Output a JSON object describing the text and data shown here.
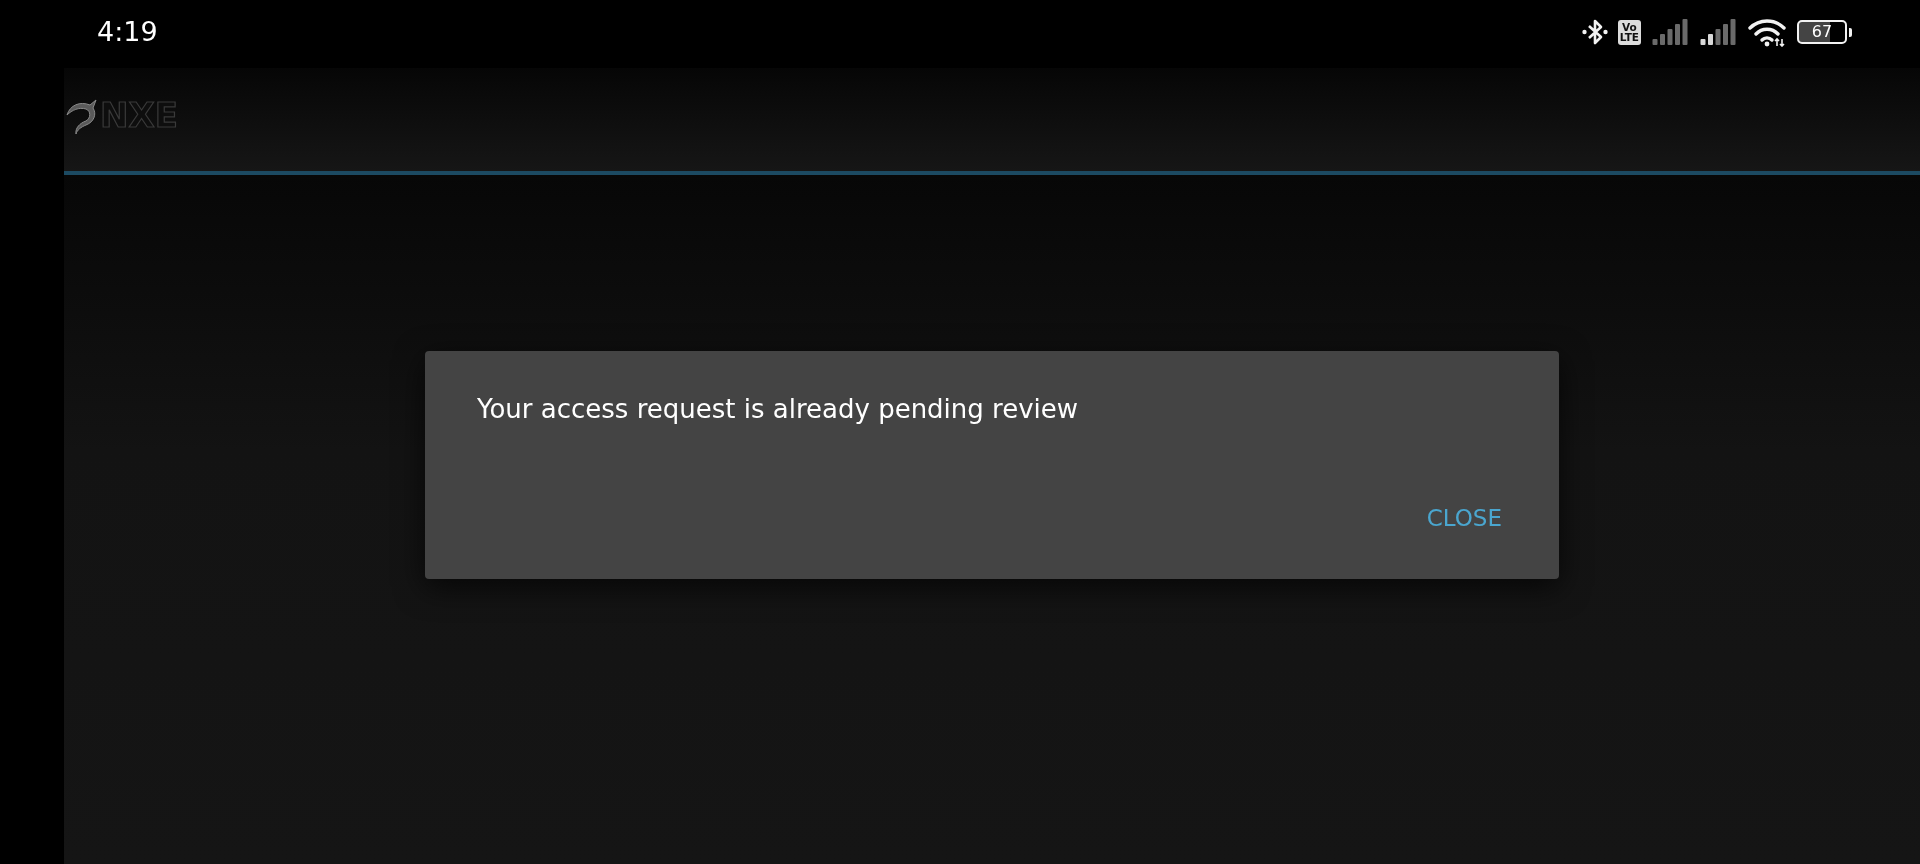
{
  "status_bar": {
    "time": "4:19",
    "volte_badge": [
      "Vo",
      "LTE"
    ],
    "battery": "67"
  },
  "app_bar": {
    "logo_text": "NXE"
  },
  "dialog": {
    "message": "Your access request is already pending review",
    "buttons": [
      "CLOSE"
    ]
  }
}
